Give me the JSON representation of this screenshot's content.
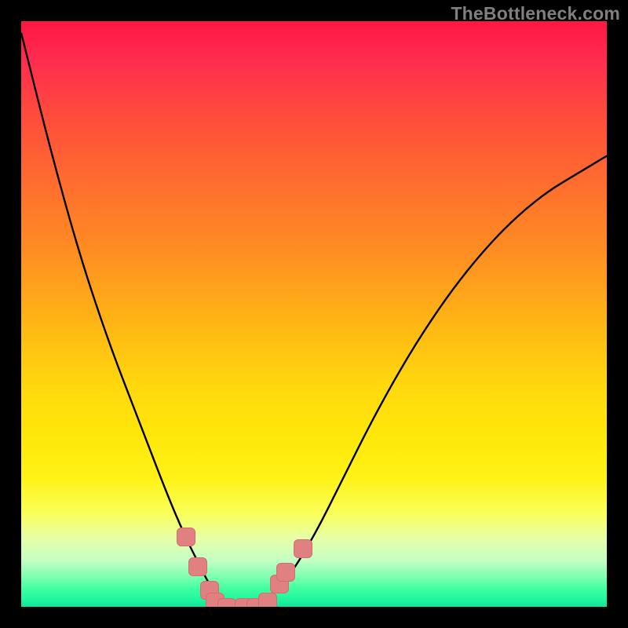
{
  "watermark": {
    "text": "TheBottleneck.com"
  },
  "colors": {
    "marker_fill": "#e08080",
    "marker_border": "#d36e6e",
    "curve": "#000000",
    "frame": "#000000"
  },
  "chart_data": {
    "type": "line",
    "title": "",
    "xlabel": "",
    "ylabel": "",
    "xlim": [
      0,
      100
    ],
    "ylim": [
      0,
      100
    ],
    "grid": false,
    "legend": false,
    "series": [
      {
        "name": "bottleneck-curve",
        "x": [
          0,
          5,
          10,
          15,
          20,
          25,
          28,
          30,
          32,
          34,
          36,
          40,
          45,
          50,
          55,
          60,
          65,
          70,
          75,
          80,
          85,
          90,
          95,
          100
        ],
        "y": [
          98,
          78,
          60,
          45,
          32,
          19,
          12,
          8,
          4,
          1,
          0,
          0,
          4,
          12,
          22,
          32,
          41,
          49,
          56,
          62,
          67,
          71,
          74,
          77
        ]
      }
    ],
    "markers": {
      "name": "highlighted-points",
      "points": [
        {
          "x": 28,
          "y": 12
        },
        {
          "x": 30,
          "y": 7
        },
        {
          "x": 32,
          "y": 3
        },
        {
          "x": 33,
          "y": 1
        },
        {
          "x": 35,
          "y": 0
        },
        {
          "x": 38,
          "y": 0
        },
        {
          "x": 40,
          "y": 0
        },
        {
          "x": 42,
          "y": 1
        },
        {
          "x": 44,
          "y": 4
        },
        {
          "x": 45,
          "y": 6
        },
        {
          "x": 48,
          "y": 10
        }
      ]
    },
    "gradient_stops": [
      {
        "pos": 0,
        "color": "#ff1744"
      },
      {
        "pos": 6,
        "color": "#ff2a50"
      },
      {
        "pos": 16,
        "color": "#ff4b3c"
      },
      {
        "pos": 28,
        "color": "#ff6e2e"
      },
      {
        "pos": 40,
        "color": "#ff8f22"
      },
      {
        "pos": 52,
        "color": "#ffb714"
      },
      {
        "pos": 62,
        "color": "#ffd70e"
      },
      {
        "pos": 70,
        "color": "#ffe60a"
      },
      {
        "pos": 78,
        "color": "#fff215"
      },
      {
        "pos": 84,
        "color": "#faff5a"
      },
      {
        "pos": 88,
        "color": "#e8ffa3"
      },
      {
        "pos": 92,
        "color": "#c4ffc4"
      },
      {
        "pos": 95,
        "color": "#7bffb0"
      },
      {
        "pos": 97,
        "color": "#3dffa0"
      },
      {
        "pos": 99,
        "color": "#1cf59d"
      },
      {
        "pos": 100,
        "color": "#14e39b"
      }
    ]
  }
}
